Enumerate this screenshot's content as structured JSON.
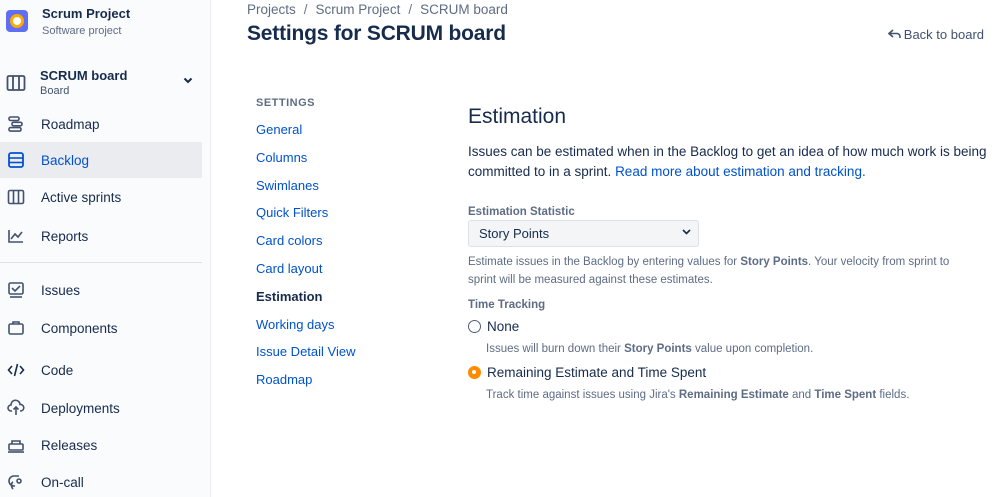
{
  "sidebar": {
    "project_name": "Scrum Project",
    "project_type": "Software project",
    "board_name": "SCRUM board",
    "board_sub": "Board",
    "items": [
      {
        "label": "Roadmap",
        "icon": "roadmap-icon"
      },
      {
        "label": "Backlog",
        "icon": "backlog-icon",
        "selected": true
      },
      {
        "label": "Active sprints",
        "icon": "sprints-icon"
      },
      {
        "label": "Reports",
        "icon": "reports-icon"
      },
      {
        "label": "Issues",
        "icon": "issues-icon"
      },
      {
        "label": "Components",
        "icon": "components-icon"
      },
      {
        "label": "Code",
        "icon": "code-icon"
      },
      {
        "label": "Deployments",
        "icon": "deployments-icon"
      },
      {
        "label": "Releases",
        "icon": "releases-icon"
      },
      {
        "label": "On-call",
        "icon": "oncall-icon"
      }
    ]
  },
  "breadcrumb": [
    "Projects",
    "Scrum Project",
    "SCRUM board"
  ],
  "header": {
    "title": "Settings for SCRUM board",
    "back_label": "Back to board"
  },
  "settings_nav": {
    "heading": "SETTINGS",
    "items": [
      "General",
      "Columns",
      "Swimlanes",
      "Quick Filters",
      "Card colors",
      "Card layout",
      "Estimation",
      "Working days",
      "Issue Detail View",
      "Roadmap"
    ],
    "active": "Estimation"
  },
  "estimation": {
    "title": "Estimation",
    "intro": "Issues can be estimated when in the Backlog to get an idea of how much work is being committed to in a sprint. ",
    "intro_link": "Read more about estimation and tracking.",
    "statistic_label": "Estimation Statistic",
    "statistic_value": "Story Points",
    "statistic_help_1": "Estimate issues in the Backlog by entering values for ",
    "statistic_help_bold": "Story Points",
    "statistic_help_2": ". Your velocity from sprint to sprint will be measured against these estimates.",
    "time_tracking_label": "Time Tracking",
    "options": [
      {
        "label": "None",
        "checked": false,
        "help_1": "Issues will burn down their ",
        "help_bold_1": "Story Points",
        "help_2": " value upon completion.",
        "help_bold_2": "",
        "help_3": ""
      },
      {
        "label": "Remaining Estimate and Time Spent",
        "checked": true,
        "help_1": "Track time against issues using Jira's ",
        "help_bold_1": "Remaining Estimate",
        "help_2": " and ",
        "help_bold_2": "Time Spent",
        "help_3": " fields."
      }
    ]
  },
  "colors": {
    "accent": "#0052cc",
    "radio_checked": "#ff8b00",
    "sidebar_selected_bg": "#ebecf0"
  }
}
